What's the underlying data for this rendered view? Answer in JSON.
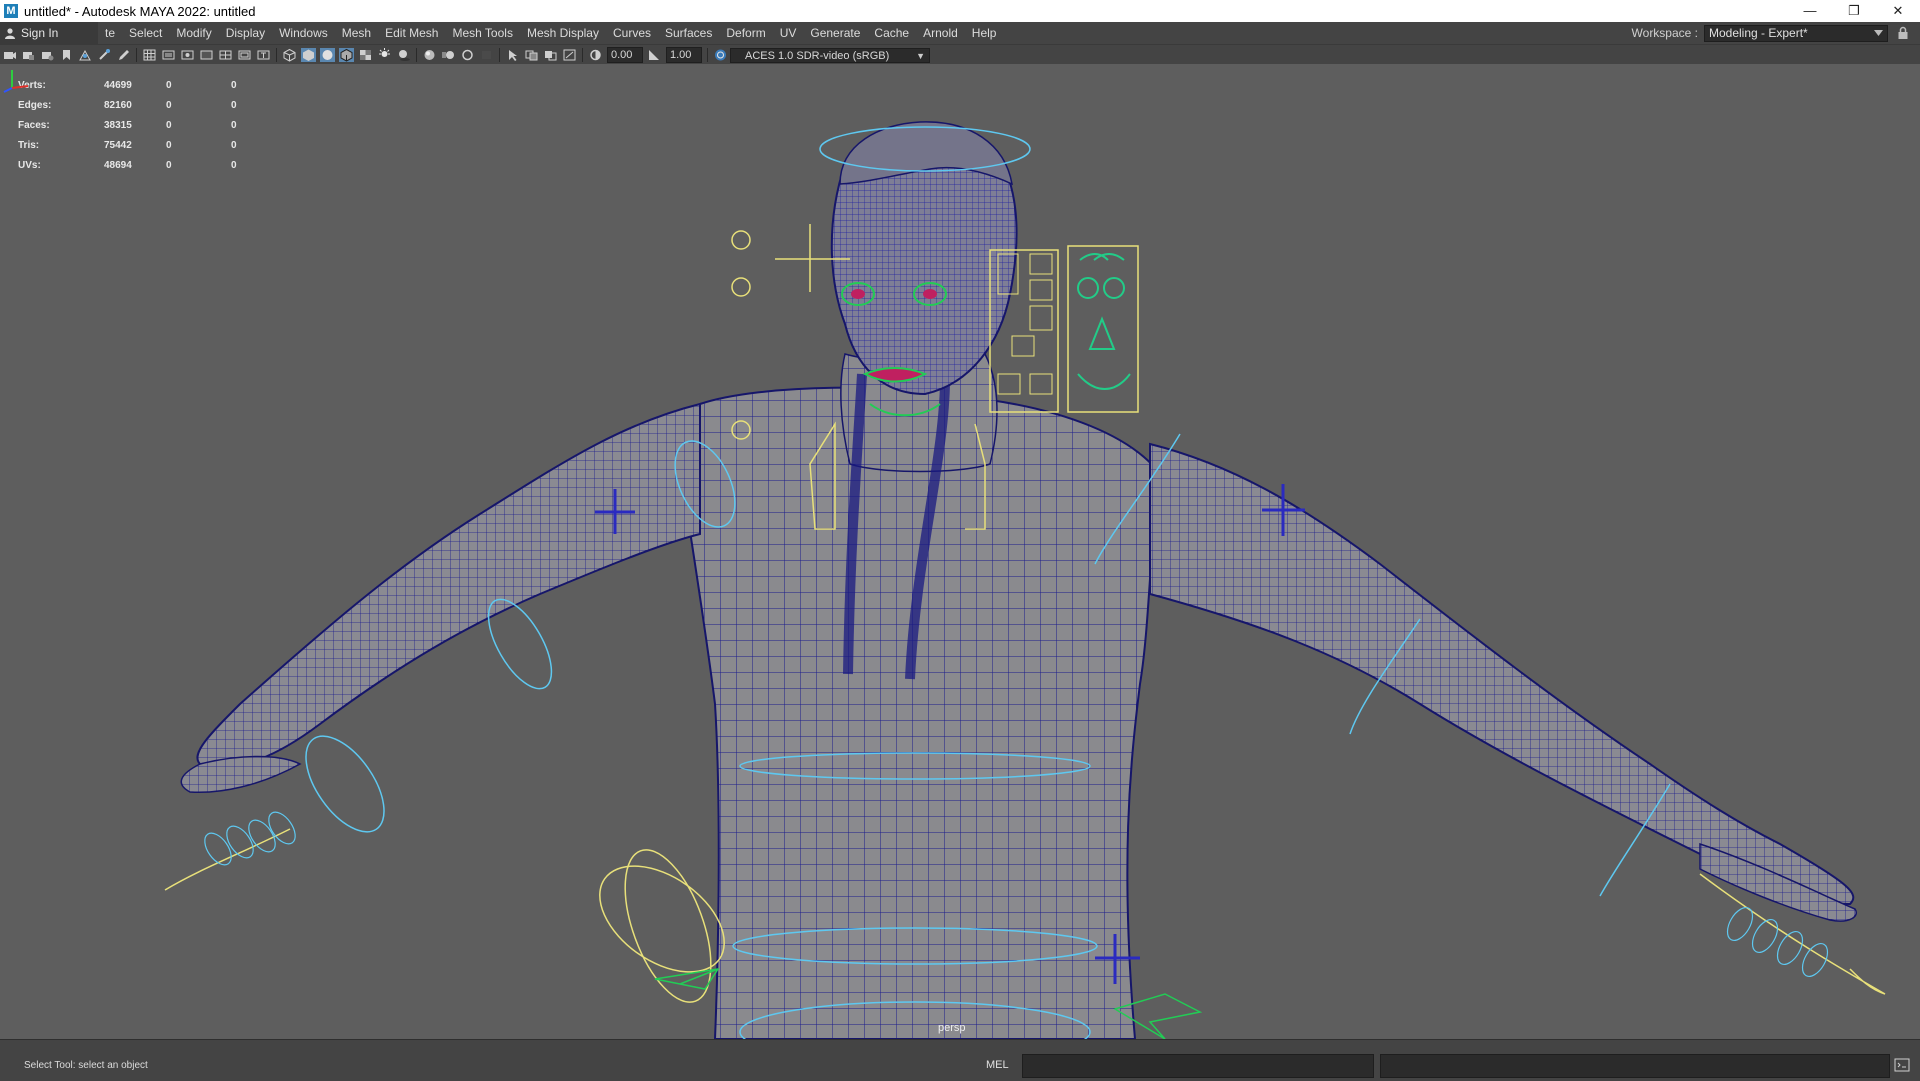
{
  "window": {
    "title": "untitled* - Autodesk MAYA 2022: untitled",
    "app_icon_letter": "M",
    "minimize_glyph": "—",
    "restore_glyph": "❐",
    "close_glyph": "✕"
  },
  "menubar": {
    "sign_in": "Sign In",
    "items": [
      "te",
      "Select",
      "Modify",
      "Display",
      "Windows",
      "Mesh",
      "Edit Mesh",
      "Mesh Tools",
      "Mesh Display",
      "Curves",
      "Surfaces",
      "Deform",
      "UV",
      "Generate",
      "Cache",
      "Arnold",
      "Help"
    ],
    "workspace_label": "Workspace :",
    "workspace_value": "Modeling - Expert*"
  },
  "toolbar": {
    "exposure": "0.00",
    "gamma": "1.00",
    "color_space": "ACES 1.0 SDR-video (sRGB)"
  },
  "hud": {
    "rows": [
      {
        "label": "Verts:",
        "v1": "44699",
        "v2": "0",
        "v3": "0"
      },
      {
        "label": "Edges:",
        "v1": "82160",
        "v2": "0",
        "v3": "0"
      },
      {
        "label": "Faces:",
        "v1": "38315",
        "v2": "0",
        "v3": "0"
      },
      {
        "label": "Tris:",
        "v1": "75442",
        "v2": "0",
        "v3": "0"
      },
      {
        "label": "UVs:",
        "v1": "48694",
        "v2": "0",
        "v3": "0"
      }
    ]
  },
  "viewport": {
    "camera": "persp",
    "background_color": "#5e5e5e",
    "mesh_color": "#8c8c8c",
    "wire_color": "#1a1a8c"
  },
  "statusbar": {
    "help_line": "Select Tool: select an object",
    "command_language": "MEL"
  }
}
